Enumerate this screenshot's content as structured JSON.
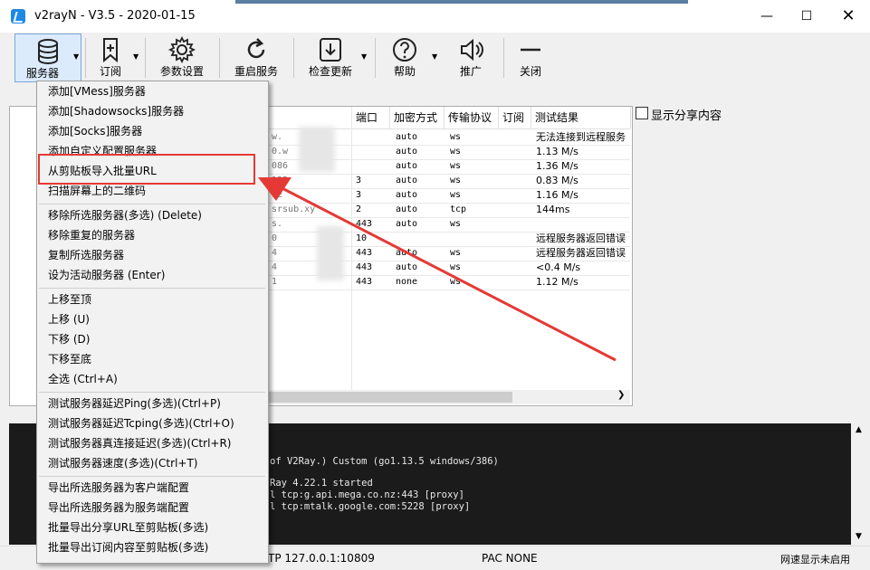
{
  "window": {
    "title": "v2rayN - V3.5 - 2020-01-15"
  },
  "toolbar": {
    "buttons": [
      {
        "label": "服务器",
        "icon": "database-icon"
      },
      {
        "label": "订阅",
        "icon": "bookmark-add-icon"
      },
      {
        "label": "参数设置",
        "icon": "gear-icon"
      },
      {
        "label": "重启服务",
        "icon": "refresh-icon"
      },
      {
        "label": "检查更新",
        "icon": "download-icon"
      },
      {
        "label": "帮助",
        "icon": "help-icon"
      },
      {
        "label": "推广",
        "icon": "speaker-icon"
      },
      {
        "label": "关闭",
        "icon": "minus-icon"
      }
    ]
  },
  "grid": {
    "headers": [
      "端口",
      "加密方式",
      "传输协议",
      "订阅",
      "测试结果"
    ],
    "rows": [
      {
        "port": "",
        "enc": "auto",
        "net": "ws",
        "result": "无法连接到远程服务"
      },
      {
        "port": "",
        "enc": "auto",
        "net": "ws",
        "result": "1.13 M/s"
      },
      {
        "port": "",
        "enc": "auto",
        "net": "ws",
        "result": "1.36 M/s"
      },
      {
        "port": "3",
        "enc": "auto",
        "net": "ws",
        "result": "0.83 M/s"
      },
      {
        "port": "3",
        "enc": "auto",
        "net": "ws",
        "result": "1.16 M/s"
      },
      {
        "port": "2",
        "enc": "auto",
        "net": "tcp",
        "result": "144ms"
      },
      {
        "port": "443",
        "enc": "auto",
        "net": "ws",
        "result": ""
      },
      {
        "port": "10",
        "enc": "",
        "net": "",
        "result": "远程服务器返回错误"
      },
      {
        "port": "443",
        "enc": "auto",
        "net": "ws",
        "result": "远程服务器返回错误"
      },
      {
        "port": "443",
        "enc": "auto",
        "net": "ws",
        "result": "<0.4 M/s"
      },
      {
        "port": "443",
        "enc": "none",
        "net": "ws",
        "result": "1.12 M/s"
      }
    ],
    "addr_fragments": [
      "w.",
      "0.w",
      "086",
      "122",
      "12",
      "srsub.xy",
      "s.",
      "0",
      "4",
      "4",
      "1"
    ]
  },
  "share_toggle": {
    "label": "显示分享内容",
    "checked": false
  },
  "log": {
    "lines": [
      "of V2Ray.) Custom (go1.13.5 windows/386)",
      "",
      "Ray 4.22.1 started",
      "l tcp:g.api.mega.co.nz:443 [proxy]",
      "l tcp:mtalk.google.com:5228 [proxy]"
    ]
  },
  "statusbar": {
    "http": "TP  127.0.0.1:10809",
    "pac": "PAC  NONE",
    "speed": "网速显示未启用"
  },
  "menu": {
    "groups": [
      [
        "添加[VMess]服务器",
        "添加[Shadowsocks]服务器",
        "添加[Socks]服务器",
        "添加自定义配置服务器",
        "从剪贴板导入批量URL",
        "扫描屏幕上的二维码"
      ],
      [
        "移除所选服务器(多选)    (Delete)",
        "移除重复的服务器",
        "复制所选服务器",
        "设为活动服务器    (Enter)"
      ],
      [
        "上移至顶",
        "上移        (U)",
        "下移        (D)",
        "下移至底",
        "全选        (Ctrl+A)"
      ],
      [
        "测试服务器延迟Ping(多选)(Ctrl+P)",
        "测试服务器延迟Tcping(多选)(Ctrl+O)",
        "测试服务器真连接延迟(多选)(Ctrl+R)",
        "测试服务器速度(多选)(Ctrl+T)"
      ],
      [
        "导出所选服务器为客户端配置",
        "导出所选服务器为服务端配置",
        "批量导出分享URL至剪贴板(多选)",
        "批量导出订阅内容至剪贴板(多选)"
      ]
    ]
  },
  "colors": {
    "highlight": "#e53935",
    "log_bg": "#1b1b1b",
    "accent": "#1e88e5"
  }
}
